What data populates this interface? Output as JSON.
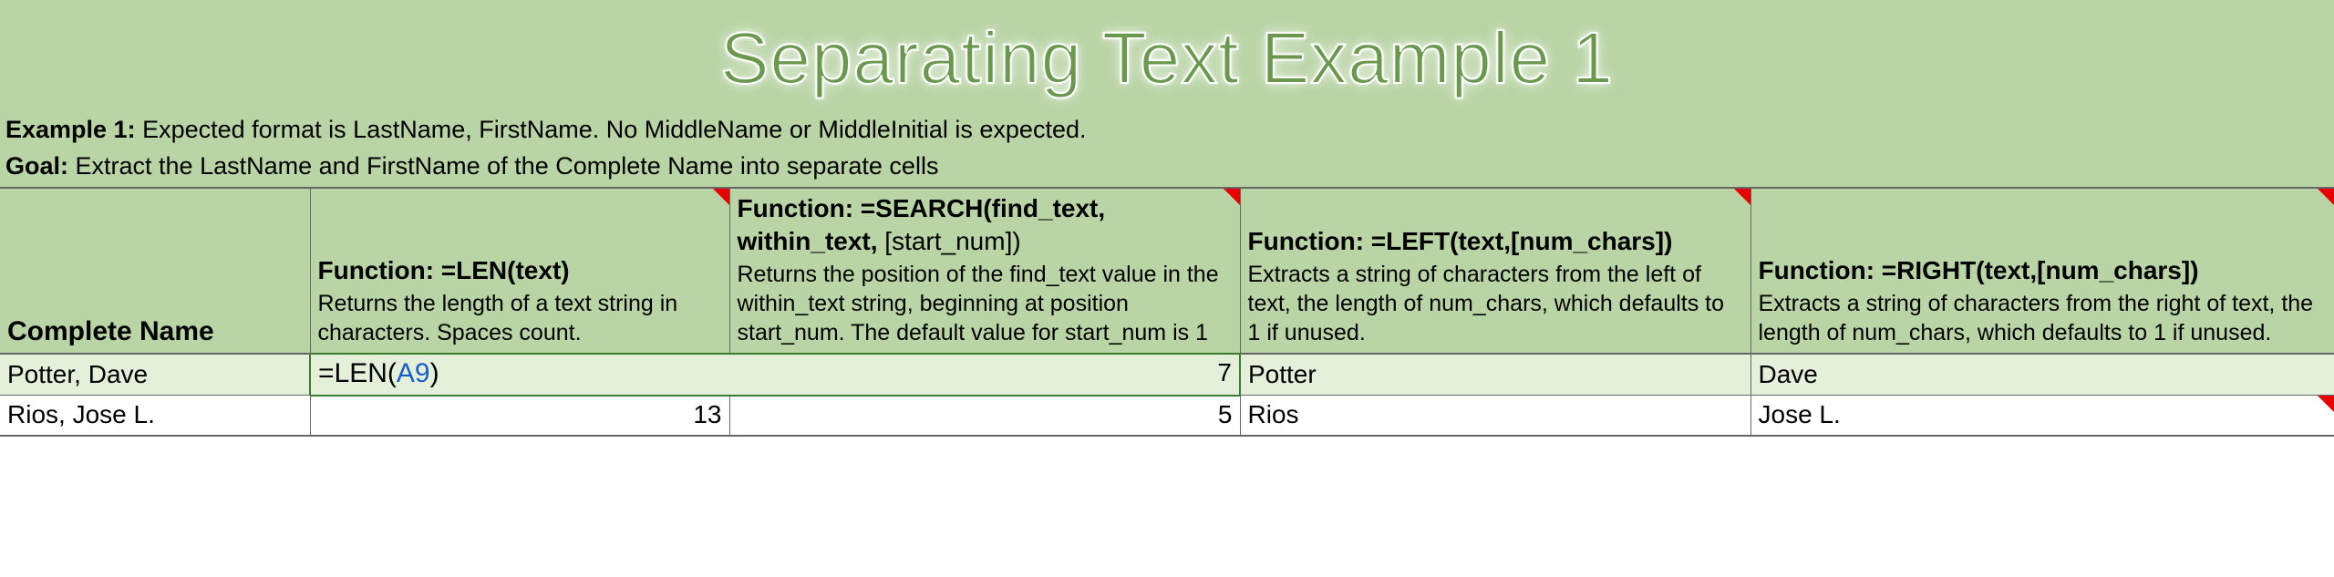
{
  "title": "Separating Text Example 1",
  "intro": {
    "example_label": "Example 1:",
    "example_text": " Expected format is LastName, FirstName. No MiddleName or MiddleInitial is expected.",
    "goal_label": "Goal:",
    "goal_text": " Extract the LastName and FirstName of the Complete Name into separate cells"
  },
  "headers": {
    "complete_name": "Complete Name",
    "len": {
      "sig_prefix": "Function:   ",
      "sig": "=LEN(text)",
      "desc": "Returns the length of a text string in characters. Spaces count."
    },
    "search": {
      "sig_prefix": "Function:   ",
      "sig_bold": "=SEARCH(find_text, within_text,",
      "sig_opt": " [start_num])",
      "desc": "Returns the position of the find_text value in the within_text string, beginning at position start_num. The default value for start_num is 1"
    },
    "left": {
      "sig_prefix": "Function:  ",
      "sig": "=LEFT(text,[num_chars])",
      "desc": "Extracts a string of characters from the left of text, the length of num_chars, which defaults to 1 if unused."
    },
    "right": {
      "sig_prefix": "Function:  ",
      "sig": "=RIGHT(text,[num_chars])",
      "desc": "Extracts a string of characters from the right of text, the length of num_chars, which defaults to 1 if unused."
    }
  },
  "rows": [
    {
      "name": "Potter, Dave",
      "len_formula_prefix": "=LEN(",
      "len_formula_ref": "A9",
      "len_formula_suffix": ")",
      "search": "7",
      "left": "Potter",
      "right": "Dave"
    },
    {
      "name": "Rios, Jose L.",
      "len": "13",
      "search": "5",
      "left": "Rios",
      "right": "Jose L."
    }
  ]
}
